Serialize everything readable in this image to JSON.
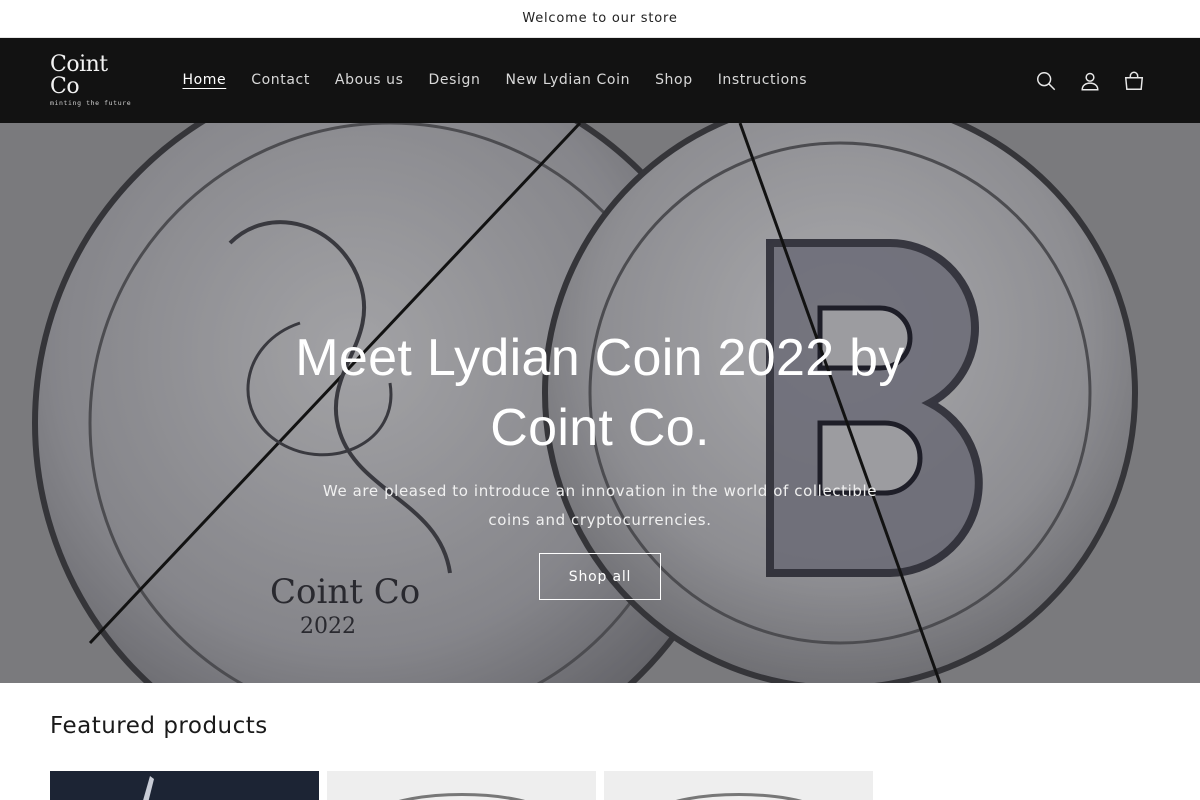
{
  "announcement": {
    "text": "Welcome to our store"
  },
  "header": {
    "logo": {
      "name": "Coint Co",
      "tagline": "minting the future"
    },
    "nav": [
      {
        "label": "Home",
        "active": true
      },
      {
        "label": "Contact"
      },
      {
        "label": "Abous us"
      },
      {
        "label": "Design"
      },
      {
        "label": "New Lydian Coin"
      },
      {
        "label": "Shop"
      },
      {
        "label": "Instructions"
      }
    ],
    "icons": [
      "search-icon",
      "account-icon",
      "cart-icon"
    ]
  },
  "hero": {
    "title": "Meet Lydian Coin 2022 by Coint Co.",
    "text": "We are pleased to introduce an innovation in the world of collectible coins and cryptocurrencies.",
    "button_label": "Shop all"
  },
  "featured": {
    "title": "Featured products",
    "products": [
      {
        "theme": "dark"
      },
      {
        "theme": "silver"
      },
      {
        "theme": "silver"
      }
    ]
  },
  "colors": {
    "header_bg": "#121212",
    "hero_tint": "#7a7a7e",
    "text": "#121212"
  }
}
